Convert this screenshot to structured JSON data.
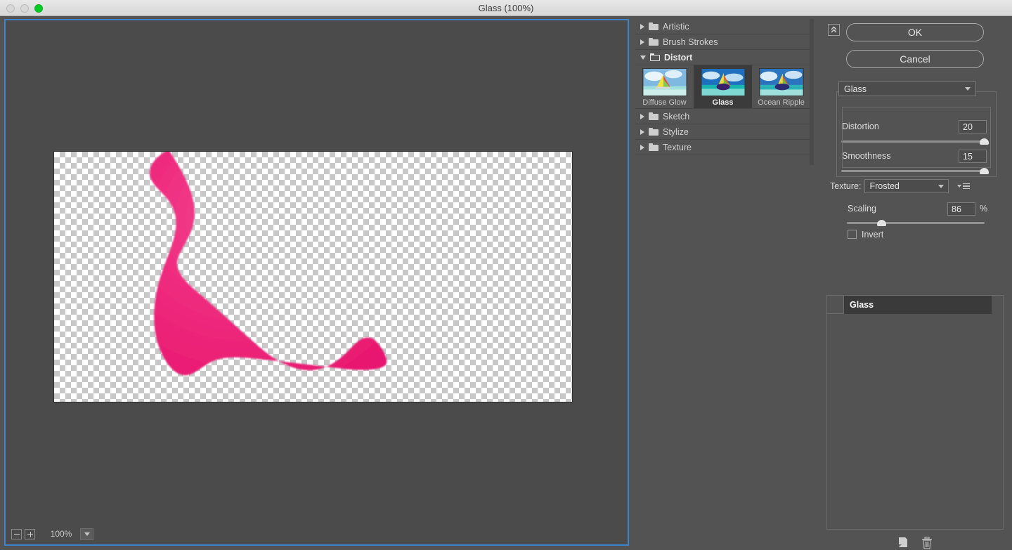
{
  "window": {
    "title": "Glass (100%)",
    "controls": {
      "close": "close-button",
      "minimize": "minimize-button",
      "maximize": "maximize-button"
    }
  },
  "preview": {
    "zoom_out_label": "zoom-out",
    "zoom_in_label": "zoom-in",
    "zoom_value": "100%",
    "zoom_menu_label": "zoom-presets"
  },
  "filter_list": {
    "categories": [
      {
        "label": "Artistic",
        "expanded": false
      },
      {
        "label": "Brush Strokes",
        "expanded": false
      },
      {
        "label": "Distort",
        "expanded": true
      },
      {
        "label": "Sketch",
        "expanded": false
      },
      {
        "label": "Stylize",
        "expanded": false
      },
      {
        "label": "Texture",
        "expanded": false
      }
    ],
    "distort_filters": [
      {
        "label": "Diffuse Glow",
        "selected": false
      },
      {
        "label": "Glass",
        "selected": true
      },
      {
        "label": "Ocean Ripple",
        "selected": false
      }
    ]
  },
  "actions": {
    "collapse_label": "collapse-panel",
    "ok_label": "OK",
    "cancel_label": "Cancel"
  },
  "settings": {
    "filter_name": "Glass",
    "distortion": {
      "label": "Distortion",
      "value": "20",
      "percent": 98
    },
    "smoothness": {
      "label": "Smoothness",
      "value": "15",
      "percent": 98
    },
    "texture": {
      "label": "Texture:",
      "value": "Frosted"
    },
    "scaling": {
      "label": "Scaling",
      "value": "86",
      "unit": "%",
      "percent": 25
    },
    "invert": {
      "label": "Invert",
      "checked": false
    }
  },
  "effect_stack": {
    "layers": [
      {
        "name": "Glass",
        "visible": false,
        "selected": true
      }
    ],
    "new_layer_label": "new-effect-layer",
    "delete_layer_label": "delete-effect-layer"
  },
  "colors": {
    "accent_border": "#3f84cb",
    "panel_bg": "#535353",
    "shape_pink": "#ef2c7f"
  }
}
